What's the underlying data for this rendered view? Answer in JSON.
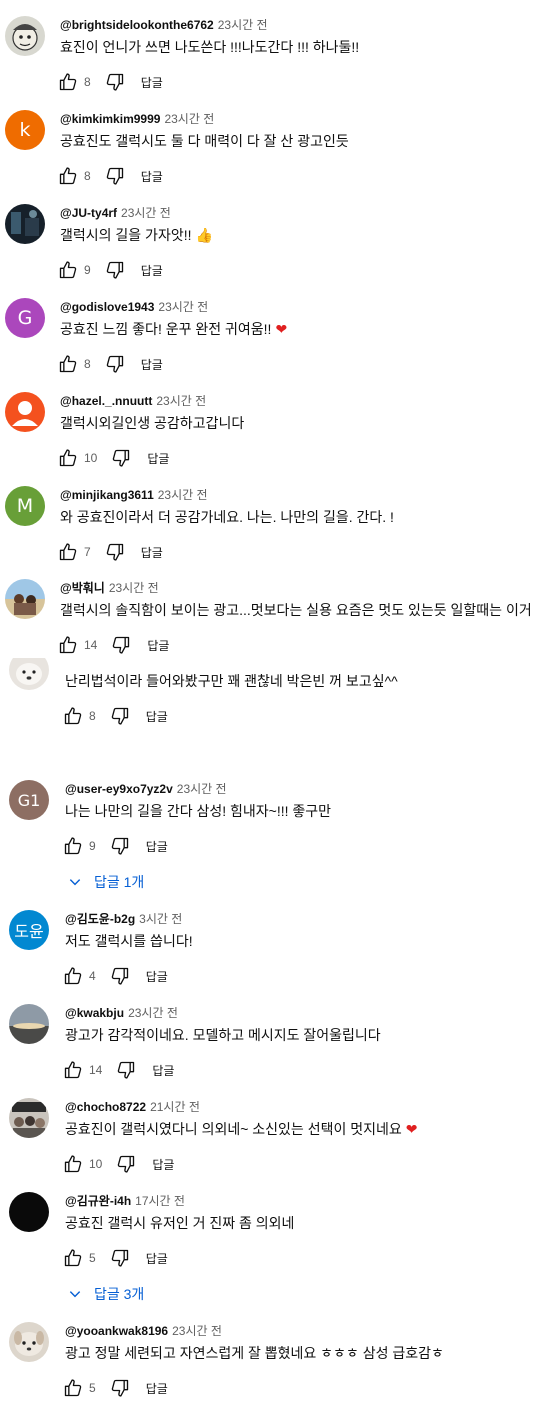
{
  "labels": {
    "reply": "답글",
    "view_replies_1": "답글 1개",
    "view_replies_3": "답글 3개"
  },
  "colors": {
    "link_blue": "#065fd4",
    "meta_gray": "#606060"
  },
  "comments": [
    {
      "author": "@brightsidelookonthe6762",
      "time": "23시간 전",
      "text": "효진이 언니가 쓰면 나도쓴다 !!!나도간다 !!! 하나둘!!",
      "likes": "8",
      "avatar_icon": "cartoon-face-avatar"
    },
    {
      "author": "@kimkimkim9999",
      "time": "23시간 전",
      "text": "공효진도 갤럭시도 둘 다 매력이 다 잘 산  광고인듯",
      "likes": "8",
      "avatar_letter": "k",
      "avatar_color": "#ef6c00"
    },
    {
      "author": "@JU-ty4rf",
      "time": "23시간 전",
      "text": "갤럭시의 길을 가자앗!!",
      "emoji": "👍",
      "likes": "9",
      "avatar_icon": "dark-photo-avatar"
    },
    {
      "author": "@godislove1943",
      "time": "23시간 전",
      "text": "공효진 느낌 좋다! 운꾸 완전 귀여움!!",
      "emoji": "❤",
      "likes": "8",
      "avatar_letter": "G",
      "avatar_color": "#ab47bc"
    },
    {
      "author": "@hazel._.nnuutt",
      "time": "23시간 전",
      "text": "갤럭시외길인생 공감하고갑니다",
      "likes": "10",
      "avatar_icon": "default-person-avatar"
    },
    {
      "author": "@minjikang3611",
      "time": "23시간 전",
      "text": "와 공효진이라서 더 공감가네요. 나는. 나만의 길을. 간다. !",
      "likes": "7",
      "avatar_letter": "M",
      "avatar_color": "#689f38"
    },
    {
      "author": "@박훠니",
      "time": "23시간 전",
      "text": "갤럭시의 솔직함이 보이는 광고...멋보다는 실용 요즘은 멋도 있는듯 일할때는 이거",
      "likes": "14",
      "avatar_icon": "beach-photo-avatar"
    },
    {
      "author": "",
      "time": "",
      "text": "난리법석이라 들어와봤구만 꽤 괜찮네 박은빈  꺼 보고싶^^",
      "likes": "8",
      "avatar_icon": "dog-photo-avatar",
      "replies_label": "view_replies_1"
    },
    {
      "author": "@user-ey9xo7yz2v",
      "time": "23시간 전",
      "text": "나는 나만의 길을 간다 삼성! 힘내자~!!! 좋구만",
      "likes": "9",
      "avatar_letter": "G1",
      "avatar_color": "#8d6e63",
      "replies_label": "view_replies_1"
    },
    {
      "author": "@김도윤-b2g",
      "time": "3시간 전",
      "text": "저도 갤럭시를 씁니다!",
      "likes": "4",
      "avatar_letter": "도윤",
      "avatar_color": "#0288d1"
    },
    {
      "author": "@kwakbju",
      "time": "23시간 전",
      "text": "광고가 감각적이네요. 모델하고 메시지도 잘어울립니다",
      "likes": "14",
      "avatar_icon": "sunset-photo-avatar"
    },
    {
      "author": "@chocho8722",
      "time": "21시간 전",
      "text": "공효진이 갤럭시였다니 의외네~ 소신있는 선택이 멋지네요",
      "emoji": "❤",
      "likes": "10",
      "avatar_icon": "group-photo-avatar"
    },
    {
      "author": "@김규완-i4h",
      "time": "17시간 전",
      "text": "공효진 갤럭시 유저인 거 진짜 좀 의외네",
      "likes": "5",
      "avatar_icon": "black-avatar",
      "replies_label": "view_replies_3"
    },
    {
      "author": "@yooankwak8196",
      "time": "23시간 전",
      "text": "광고 정말 세련되고 자연스럽게 잘 뽑혔네요 ㅎㅎㅎ 삼성 급호감ㅎ",
      "likes": "5",
      "avatar_icon": "puppy-photo-avatar"
    }
  ]
}
